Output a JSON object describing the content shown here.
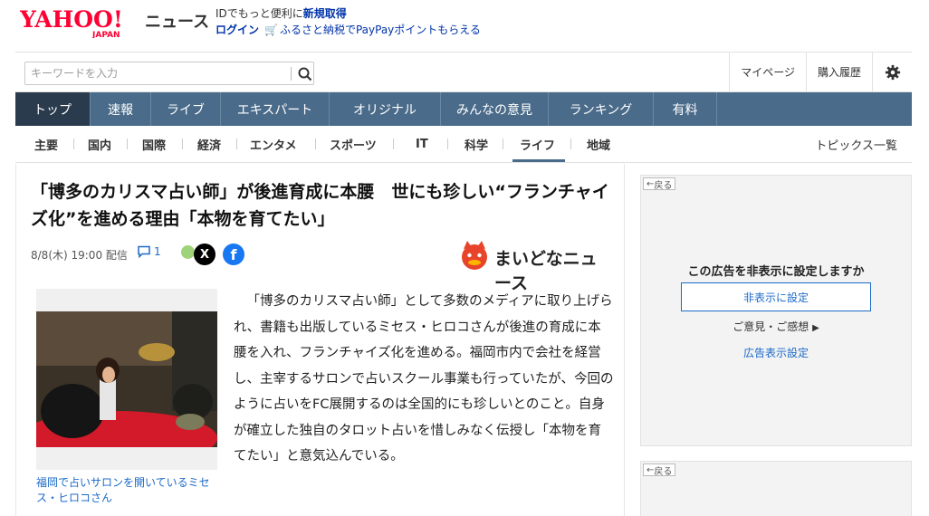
{
  "header": {
    "logo_text": "YAHOO!",
    "logo_sub": "JAPAN",
    "logo_service": "ニュース",
    "id_text": "IDでもっと便利に",
    "id_link": "新規取得",
    "login": "ログイン",
    "promo": "ふるさと納税でPayPayポイントもらえる"
  },
  "search": {
    "placeholder": "キーワードを入力"
  },
  "top_links": [
    "マイページ",
    "購入履歴"
  ],
  "main_tabs": [
    "トップ",
    "速報",
    "ライブ",
    "エキスパート",
    "オリジナル",
    "みんなの意見",
    "ランキング",
    "有料"
  ],
  "sub_tabs": [
    "主要",
    "国内",
    "国際",
    "経済",
    "エンタメ",
    "スポーツ",
    "IT",
    "科学",
    "ライフ",
    "地域"
  ],
  "topics_link": "トピックス一覧",
  "article": {
    "headline": "「博多のカリスマ占い師」が後進育成に本腰　世にも珍しい“フランチャイズ化”を進める理由「本物を育てたい」",
    "date": "8/8(木) 19:00 配信",
    "comment_count": "1",
    "publisher": "まいどなニュース",
    "caption": "福岡で占いサロンを開いているミセス・ヒロコさん",
    "body": "「博多のカリスマ占い師」として多数のメディアに取り上げられ、書籍も出版しているミセス・ヒロコさんが後進の育成に本腰を入れ、フランチャイズ化を進める。福岡市内で会社を経営し、主宰するサロンで占いスクール事業も行っていたが、今回のように占いをFC展開するのは全国的にも珍しいとのこと。自身が確立した独自のタロット占いを惜しみなく伝授し「本物を育てたい」と意気込んでいる。"
  },
  "ad": {
    "back": "戻る",
    "question": "この広告を非表示に設定しますか",
    "hide_button": "非表示に設定",
    "feedback": "ご意見・ご感想",
    "settings": "広告表示設定"
  }
}
